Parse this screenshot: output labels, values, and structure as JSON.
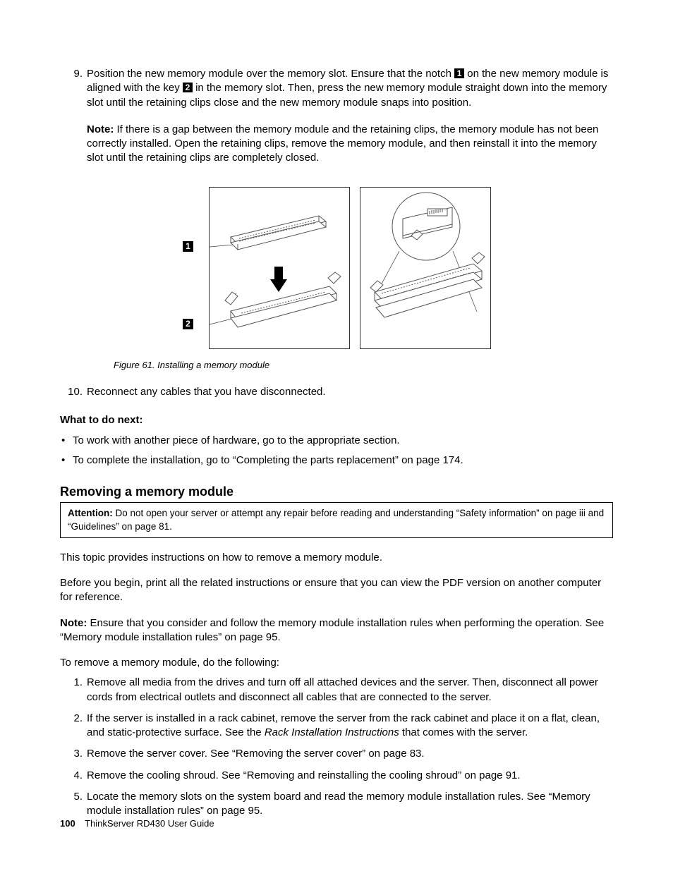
{
  "step9": {
    "num": "9.",
    "text_a": "Position the new memory module over the memory slot. Ensure that the notch ",
    "callout1": "1",
    "text_b": " on the new memory module is aligned with the key ",
    "callout2": "2",
    "text_c": " in the memory slot. Then, press the new memory module straight down into the memory slot until the retaining clips close and the new memory module snaps into position.",
    "note_label": "Note:",
    "note_text": " If there is a gap between the memory module and the retaining clips, the memory module has not been correctly installed. Open the retaining clips, remove the memory module, and then reinstall it into the memory slot until the retaining clips are completely closed."
  },
  "figure": {
    "label1": "1",
    "label2": "2",
    "caption": "Figure 61.  Installing a memory module"
  },
  "step10": {
    "num": "10.",
    "text": "Reconnect any cables that you have disconnected."
  },
  "what_next": {
    "heading": "What to do next:",
    "b1": "To work with another piece of hardware, go to the appropriate section.",
    "b2": "To complete the installation, go to “Completing the parts replacement” on page 174."
  },
  "section": {
    "title": "Removing a memory module",
    "attention_label": "Attention:",
    "attention_text": " Do not open your server or attempt any repair before reading and understanding “Safety information” on page iii and “Guidelines” on page 81.",
    "p1": "This topic provides instructions on how to remove a memory module.",
    "p2": "Before you begin, print all the related instructions or ensure that you can view the PDF version on another computer for reference.",
    "note_label": "Note:",
    "note_text": " Ensure that you consider and follow the memory module installation rules when performing the operation. See “Memory module installation rules” on page 95.",
    "intro": "To remove a memory module, do the following:",
    "s1": {
      "num": "1.",
      "text": "Remove all media from the drives and turn off all attached devices and the server. Then, disconnect all power cords from electrical outlets and disconnect all cables that are connected to the server."
    },
    "s2": {
      "num": "2.",
      "text_a": "If the server is installed in a rack cabinet, remove the server from the rack cabinet and place it on a flat, clean, and static-protective surface. See the ",
      "ital": "Rack Installation Instructions",
      "text_b": " that comes with the server."
    },
    "s3": {
      "num": "3.",
      "text": "Remove the server cover. See “Removing the server cover” on page 83."
    },
    "s4": {
      "num": "4.",
      "text": "Remove the cooling shroud. See “Removing and reinstalling the cooling shroud” on page 91."
    },
    "s5": {
      "num": "5.",
      "text": "Locate the memory slots on the system board and read the memory module installation rules. See “Memory module installation rules” on page 95."
    }
  },
  "footer": {
    "page": "100",
    "title": "ThinkServer RD430 User Guide"
  }
}
